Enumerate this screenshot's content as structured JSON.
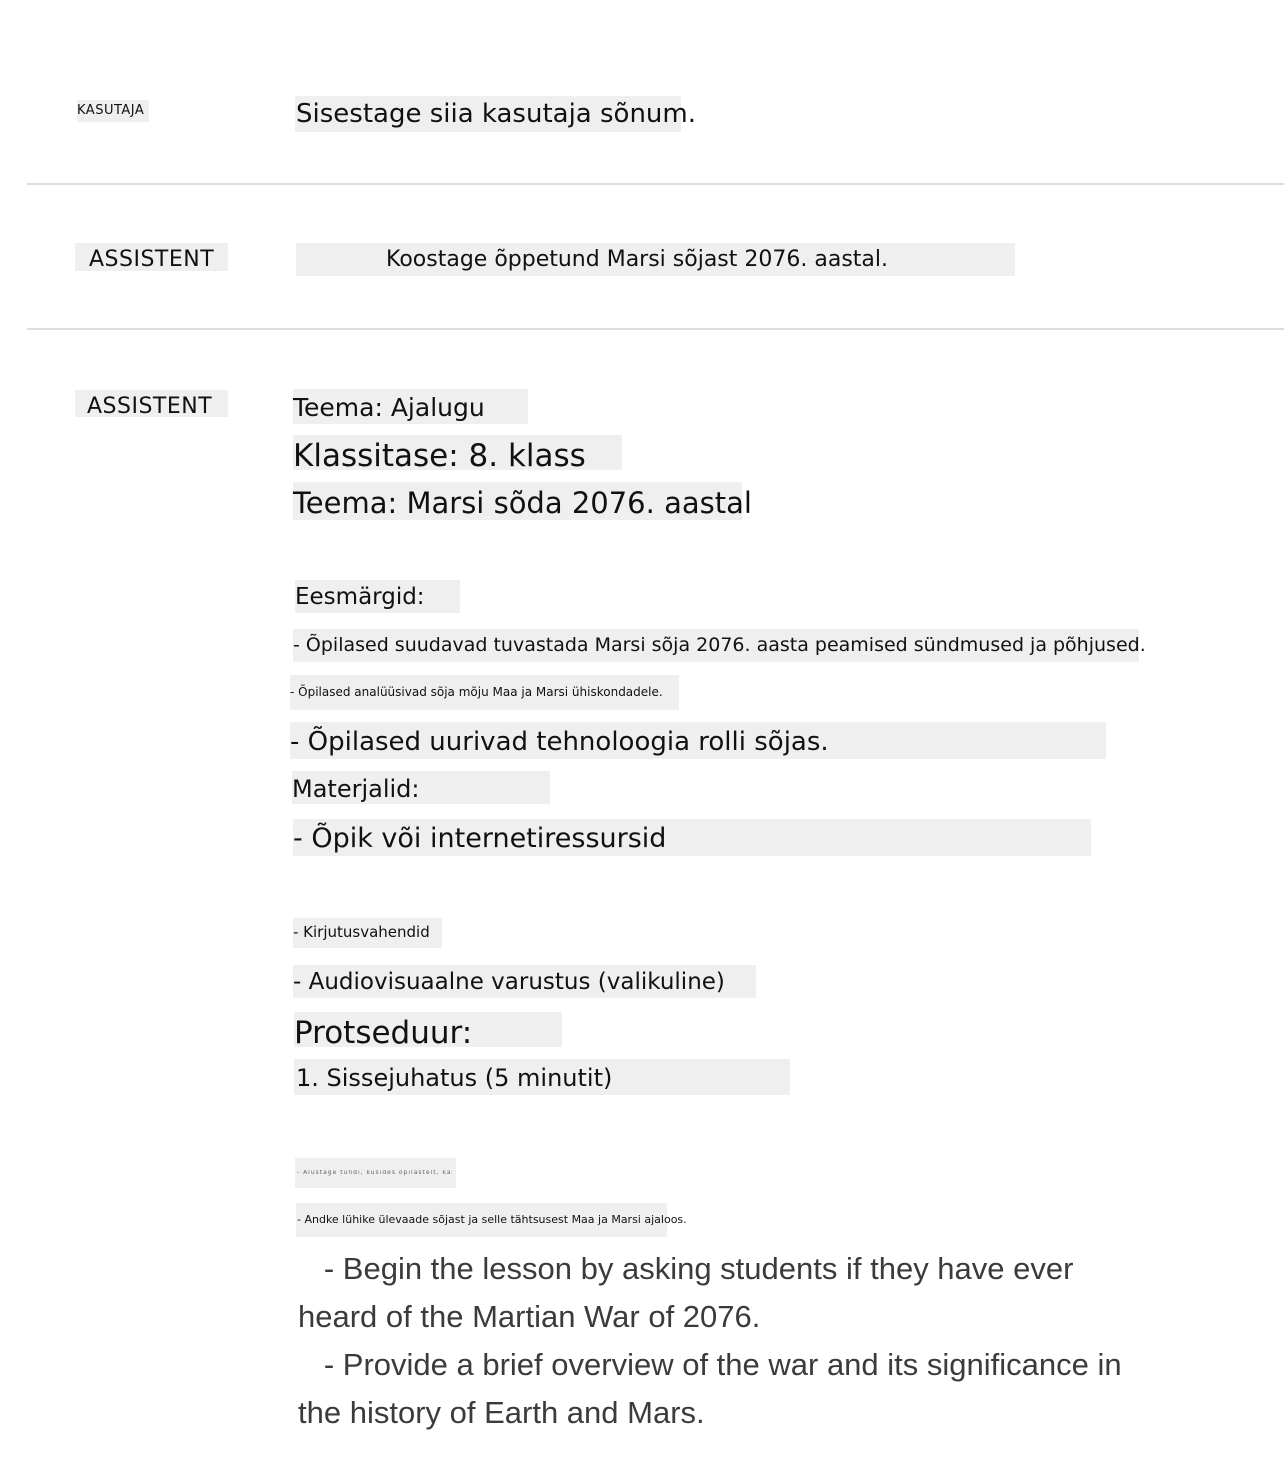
{
  "messages": [
    {
      "role": "KASUTAJA",
      "text": "Sisestage siia kasutaja sõnum."
    },
    {
      "role": "ASSISTENT",
      "text": "Koostage õppetund Marsi sõjast 2076. aastal."
    },
    {
      "role": "ASSISTENT",
      "lines": [
        "Teema: Ajalugu",
        "Klassitase: 8. klass",
        "Teema: Marsi sõda 2076. aastal",
        "Eesmärgid:",
        "- Õpilased suudavad tuvastada Marsi sõja 2076. aasta peamised sündmused ja põhjused.",
        "- Õpilased analüüsivad sõja mõju Maa ja Marsi ühiskondadele.",
        "- Õpilased uurivad tehnoloogia rolli sõjas.",
        "Materjalid:",
        "- Õpik või internetiressursid",
        "- Kirjutusvahendid",
        "- Audiovisuaalne varustus (valikuline)",
        "Protseduur:",
        "1. Sissejuhatus (5 minutit)",
        "- Alustage tundi, küsides õpilastelt, kas nad on kunagi kuulnud Marsi sõjast 2076.",
        "- Andke lühike ülevaade sõjast ja selle tähtsusest Maa ja Marsi ajaloos."
      ],
      "english": [
        "   - Begin the lesson by asking students if they have ever heard of the Martian War of 2076.",
        "   - Provide a brief overview of the war and its significance in the history of Earth and Mars."
      ]
    }
  ]
}
